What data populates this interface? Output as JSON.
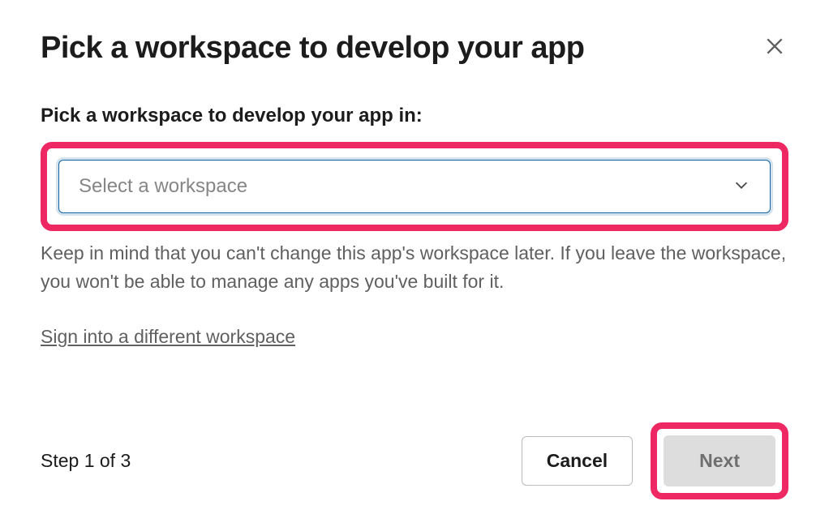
{
  "header": {
    "title": "Pick a workspace to develop your app"
  },
  "form": {
    "label": "Pick a workspace to develop your app in:",
    "select_placeholder": "Select a workspace",
    "helper_text": "Keep in mind that you can't change this app's workspace later. If you leave the workspace, you won't be able to manage any apps you've built for it.",
    "signin_link": "Sign into a different workspace"
  },
  "footer": {
    "step_text": "Step 1 of 3",
    "cancel_label": "Cancel",
    "next_label": "Next"
  }
}
